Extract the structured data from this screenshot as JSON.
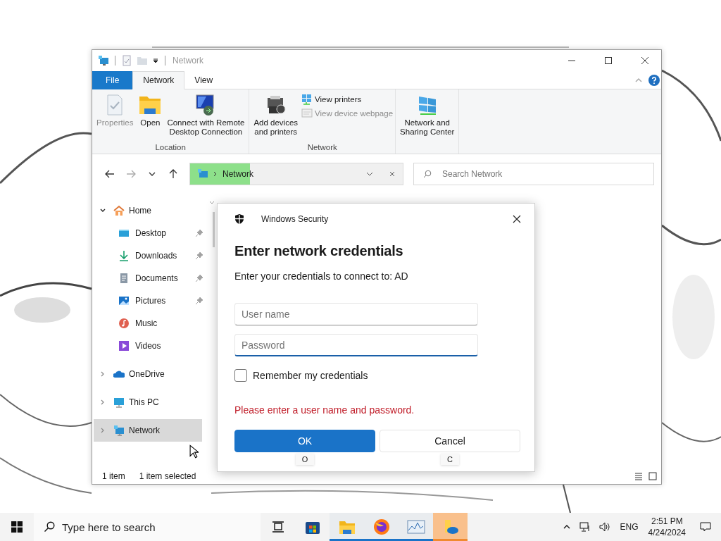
{
  "explorer": {
    "title": "Network",
    "ribbon_tabs": [
      {
        "label": "File",
        "kind": "file",
        "selected": false
      },
      {
        "label": "Network",
        "kind": "tab",
        "selected": true
      },
      {
        "label": "View",
        "kind": "tab",
        "selected": false
      }
    ],
    "ribbon_groups": [
      {
        "label": "Location",
        "items": [
          {
            "label": "Properties",
            "kind": "large",
            "disabled": true
          },
          {
            "label": "Open",
            "kind": "large",
            "disabled": false
          },
          {
            "label": "Connect with Remote\nDesktop Connection",
            "kind": "large",
            "disabled": false
          }
        ]
      },
      {
        "label": "Network",
        "items": [
          {
            "label": "Add devices\nand printers",
            "kind": "large",
            "disabled": false
          },
          {
            "label": "View printers",
            "kind": "small",
            "disabled": false
          },
          {
            "label": "View device webpage",
            "kind": "small",
            "disabled": true
          }
        ]
      },
      {
        "items": [
          {
            "label": "Network and\nSharing Center",
            "kind": "large",
            "disabled": false
          }
        ]
      }
    ],
    "nav": [
      {
        "kind": "back",
        "disabled": false
      },
      {
        "kind": "forward",
        "disabled": true
      },
      {
        "kind": "recent",
        "disabled": false
      },
      {
        "kind": "up",
        "disabled": false
      }
    ],
    "address": {
      "crumb": "Network",
      "level": 0.28
    },
    "search": {
      "placeholder": "Search Network"
    },
    "tree": [
      {
        "label": "Home",
        "expanded": true,
        "selected": false,
        "children": [
          {
            "label": "Desktop",
            "pinned": true
          },
          {
            "label": "Downloads",
            "pinned": true
          },
          {
            "label": "Documents",
            "pinned": true
          },
          {
            "label": "Pictures",
            "pinned": true
          },
          {
            "label": "Music",
            "pinned": false
          },
          {
            "label": "Videos",
            "pinned": false
          }
        ]
      },
      {
        "label": "OneDrive",
        "expanded": false,
        "selected": false
      },
      {
        "label": "This PC",
        "expanded": false,
        "selected": false
      },
      {
        "label": "Network",
        "expanded": false,
        "selected": true
      }
    ],
    "status": [
      "1 item",
      "1 item selected"
    ]
  },
  "dialog": {
    "app": "Windows Security",
    "heading": "Enter network credentials",
    "message": "Enter your credentials to connect to: AD",
    "fields": [
      {
        "placeholder": "User name",
        "focused": false
      },
      {
        "placeholder": "Password",
        "focused": true
      }
    ],
    "remember": {
      "label": "Remember my credentials",
      "checked": false
    },
    "error": "Please enter a user name and password.",
    "buttons": [
      {
        "label": "OK",
        "kind": "primary",
        "access_key": "O"
      },
      {
        "label": "Cancel",
        "kind": "secondary",
        "access_key": "C"
      }
    ]
  },
  "taskbar": {
    "search_placeholder": "Type here to search",
    "apps": [
      {
        "kind": "taskview",
        "running": false,
        "selected": false
      },
      {
        "kind": "store",
        "running": false,
        "selected": false
      },
      {
        "kind": "explorer",
        "running": true,
        "selected": false
      },
      {
        "kind": "firefox",
        "running": true,
        "selected": false
      },
      {
        "kind": "monitor",
        "running": true,
        "selected": false
      },
      {
        "kind": "photos",
        "running": true,
        "selected": true
      }
    ],
    "language": "ENG",
    "time": "2:51 PM",
    "date": "4/24/2024"
  }
}
